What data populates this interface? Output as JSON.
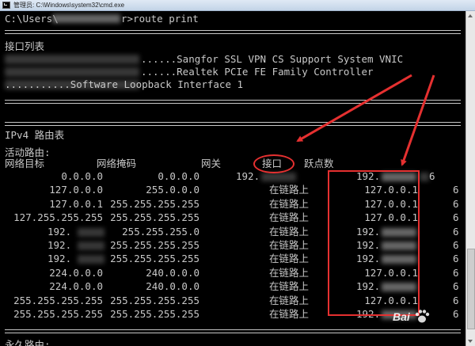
{
  "window": {
    "title": "管理员: C:\\Windows\\system32\\cmd.exe",
    "app_icon": "cmd-icon"
  },
  "console": {
    "prompt_prefix": "C:\\Users\\",
    "prompt_suffix": "r>route print",
    "interface_list_header": "接口列表",
    "interfaces": [
      "......Sangfor SSL VPN CS Support System VNIC",
      "......Realtek PCIe FE Family Controller",
      "...........Software Loopback Interface 1"
    ],
    "ipv4_header": "IPv4 路由表",
    "active_routes_label": "活动路由:",
    "columns": {
      "destination": "网络目标",
      "netmask": "网络掩码",
      "gateway": "网关",
      "interface": "接口",
      "metric": "跃点数"
    },
    "routes": [
      {
        "destination": "0.0.0.0",
        "netmask": "0.0.0.0",
        "gateway": "192.",
        "interface": "192.",
        "metric": "6"
      },
      {
        "destination": "127.0.0.0",
        "netmask": "255.0.0.0",
        "gateway": "在链路上",
        "interface": "127.0.0.1",
        "metric": "6"
      },
      {
        "destination": "127.0.0.1",
        "netmask": "255.255.255.255",
        "gateway": "在链路上",
        "interface": "127.0.0.1",
        "metric": "6"
      },
      {
        "destination": "127.255.255.255",
        "netmask": "255.255.255.255",
        "gateway": "在链路上",
        "interface": "127.0.0.1",
        "metric": "6"
      },
      {
        "destination": "192.",
        "netmask": "255.255.255.0",
        "gateway": "在链路上",
        "interface": "192.",
        "metric": "6"
      },
      {
        "destination": "192.",
        "netmask": "255.255.255.255",
        "gateway": "在链路上",
        "interface": "192.",
        "metric": "6"
      },
      {
        "destination": "192.",
        "netmask": "255.255.255.255",
        "gateway": "在链路上",
        "interface": "192.",
        "metric": "6"
      },
      {
        "destination": "224.0.0.0",
        "netmask": "240.0.0.0",
        "gateway": "在链路上",
        "interface": "127.0.0.1",
        "metric": "6"
      },
      {
        "destination": "224.0.0.0",
        "netmask": "240.0.0.0",
        "gateway": "在链路上",
        "interface": "192.",
        "metric": "6"
      },
      {
        "destination": "255.255.255.255",
        "netmask": "255.255.255.255",
        "gateway": "在链路上",
        "interface": "127.0.0.1",
        "metric": "6"
      },
      {
        "destination": "255.255.255.255",
        "netmask": "255.255.255.255",
        "gateway": "在链路上",
        "interface": "192.",
        "metric": "6"
      }
    ],
    "persistent_routes_label": "永久路由:"
  },
  "annotations": {
    "color": "#e53030"
  },
  "watermark": {
    "text": "Bai"
  }
}
